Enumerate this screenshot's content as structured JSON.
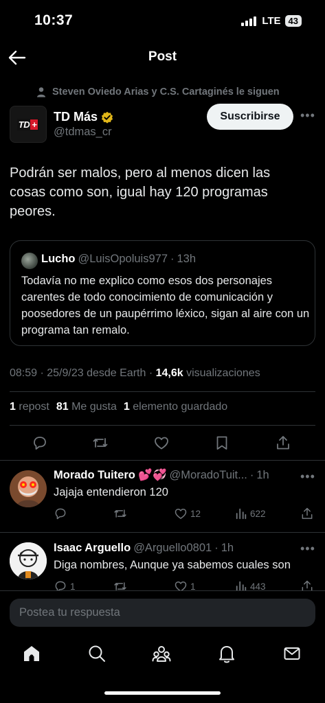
{
  "status_bar": {
    "time": "10:37",
    "network": "LTE",
    "battery": "43"
  },
  "nav": {
    "title": "Post"
  },
  "post": {
    "social_context": "Steven Oviedo Arias y C.S. Cartaginés le siguen",
    "author_logo": "TD",
    "author_name": "TD Más",
    "author_handle": "@tdmas_cr",
    "subscribe_label": "Suscribirse",
    "text": "Podrán ser malos, pero al menos dicen las cosas como son, igual hay 120 programas peores.",
    "quote": {
      "name": "Lucho",
      "handle": "@LuisOpoluis977",
      "time": "13h",
      "text": "Todavía no me explico como esos dos personajes carentes de todo conocimiento de comunicación y poosedores de un paupérrimo léxico, sigan al aire con un programa tan remalo."
    },
    "timestamp": "08:59 · 25/9/23 desde Earth · ",
    "views_count": "14,6k",
    "views_label": "visualizaciones",
    "stats": {
      "reposts_count": "1",
      "reposts_label": "repost",
      "likes_count": "81",
      "likes_label": "Me gusta",
      "bookmarks_count": "1",
      "bookmarks_label": "elemento guardado"
    }
  },
  "replies": [
    {
      "name": "Morado Tuitero 💕💞",
      "handle": "@MoradoTuit...",
      "time": "1h",
      "text": "Jajaja entendieron 120",
      "replies": "",
      "reposts": "",
      "likes": "12",
      "views": "622"
    },
    {
      "name": "Isaac Arguello",
      "handle": "@Arguello0801",
      "time": "1h",
      "text": "Diga nombres, Aunque ya sabemos cuales son",
      "replies": "1",
      "reposts": "",
      "likes": "1",
      "views": "443"
    }
  ],
  "composer": {
    "placeholder": "Postea tu respuesta"
  },
  "colors": {
    "background": "#000000",
    "text": "#e7e9ea",
    "muted": "#71767b",
    "verified": "#e2b719",
    "divider": "#2f3336"
  }
}
